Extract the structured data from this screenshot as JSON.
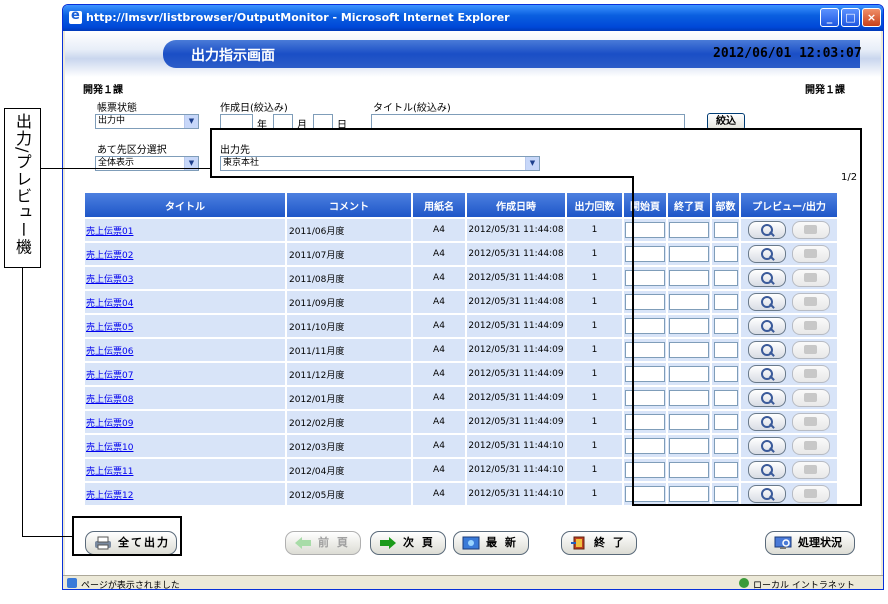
{
  "window": {
    "title": "http://lmsvr/listbrowser/OutputMonitor - Microsoft Internet Explorer",
    "minimize": "_",
    "maximize": "□",
    "close": "×"
  },
  "header": {
    "screen_title": "出力指示画面",
    "datetime": "2012/06/01 12:03:07",
    "dept_left": "開発１課",
    "dept_right": "開発１課"
  },
  "filters": {
    "status_label": "帳票状態",
    "status_value": "出力中",
    "created_label": "作成日(絞込み)",
    "year_unit": "年",
    "month_unit": "月",
    "day_unit": "日",
    "title_label": "タイトル(絞込み)",
    "filter_button": "絞込",
    "dest_class_label": "あて先区分選択",
    "dest_class_value": "全体表示",
    "output_dest_label": "出力先",
    "output_dest_value": "東京本社",
    "page_indicator": "1/2"
  },
  "table": {
    "headers": [
      "タイトル",
      "コメント",
      "用紙名",
      "作成日時",
      "出力回数",
      "開始頁",
      "終了頁",
      "部数",
      "プレビュー/出力"
    ],
    "rows": [
      {
        "title": "売上伝票01",
        "comment": "2011/06月度",
        "paper": "A4",
        "created": "2012/05/31 11:44:08",
        "count": "1"
      },
      {
        "title": "売上伝票02",
        "comment": "2011/07月度",
        "paper": "A4",
        "created": "2012/05/31 11:44:08",
        "count": "1"
      },
      {
        "title": "売上伝票03",
        "comment": "2011/08月度",
        "paper": "A4",
        "created": "2012/05/31 11:44:08",
        "count": "1"
      },
      {
        "title": "売上伝票04",
        "comment": "2011/09月度",
        "paper": "A4",
        "created": "2012/05/31 11:44:08",
        "count": "1"
      },
      {
        "title": "売上伝票05",
        "comment": "2011/10月度",
        "paper": "A4",
        "created": "2012/05/31 11:44:09",
        "count": "1"
      },
      {
        "title": "売上伝票06",
        "comment": "2011/11月度",
        "paper": "A4",
        "created": "2012/05/31 11:44:09",
        "count": "1"
      },
      {
        "title": "売上伝票07",
        "comment": "2011/12月度",
        "paper": "A4",
        "created": "2012/05/31 11:44:09",
        "count": "1"
      },
      {
        "title": "売上伝票08",
        "comment": "2012/01月度",
        "paper": "A4",
        "created": "2012/05/31 11:44:09",
        "count": "1"
      },
      {
        "title": "売上伝票09",
        "comment": "2012/02月度",
        "paper": "A4",
        "created": "2012/05/31 11:44:09",
        "count": "1"
      },
      {
        "title": "売上伝票10",
        "comment": "2012/03月度",
        "paper": "A4",
        "created": "2012/05/31 11:44:10",
        "count": "1"
      },
      {
        "title": "売上伝票11",
        "comment": "2012/04月度",
        "paper": "A4",
        "created": "2012/05/31 11:44:10",
        "count": "1"
      },
      {
        "title": "売上伝票12",
        "comment": "2012/05月度",
        "paper": "A4",
        "created": "2012/05/31 11:44:10",
        "count": "1"
      }
    ]
  },
  "footer": {
    "print_all": "全て出力",
    "prev": "前 頁",
    "next": "次 頁",
    "refresh": "最 新",
    "exit": "終 了",
    "status": "処理状況"
  },
  "statusbar": {
    "message": "ページが表示されました",
    "zone": "ローカル イントラネット"
  },
  "annotation": {
    "label": "出力/プレビュー機能"
  },
  "colors": {
    "header_blue": "#1e56c8",
    "row_bg": "#d8e4f8",
    "link": "#0000ee"
  }
}
